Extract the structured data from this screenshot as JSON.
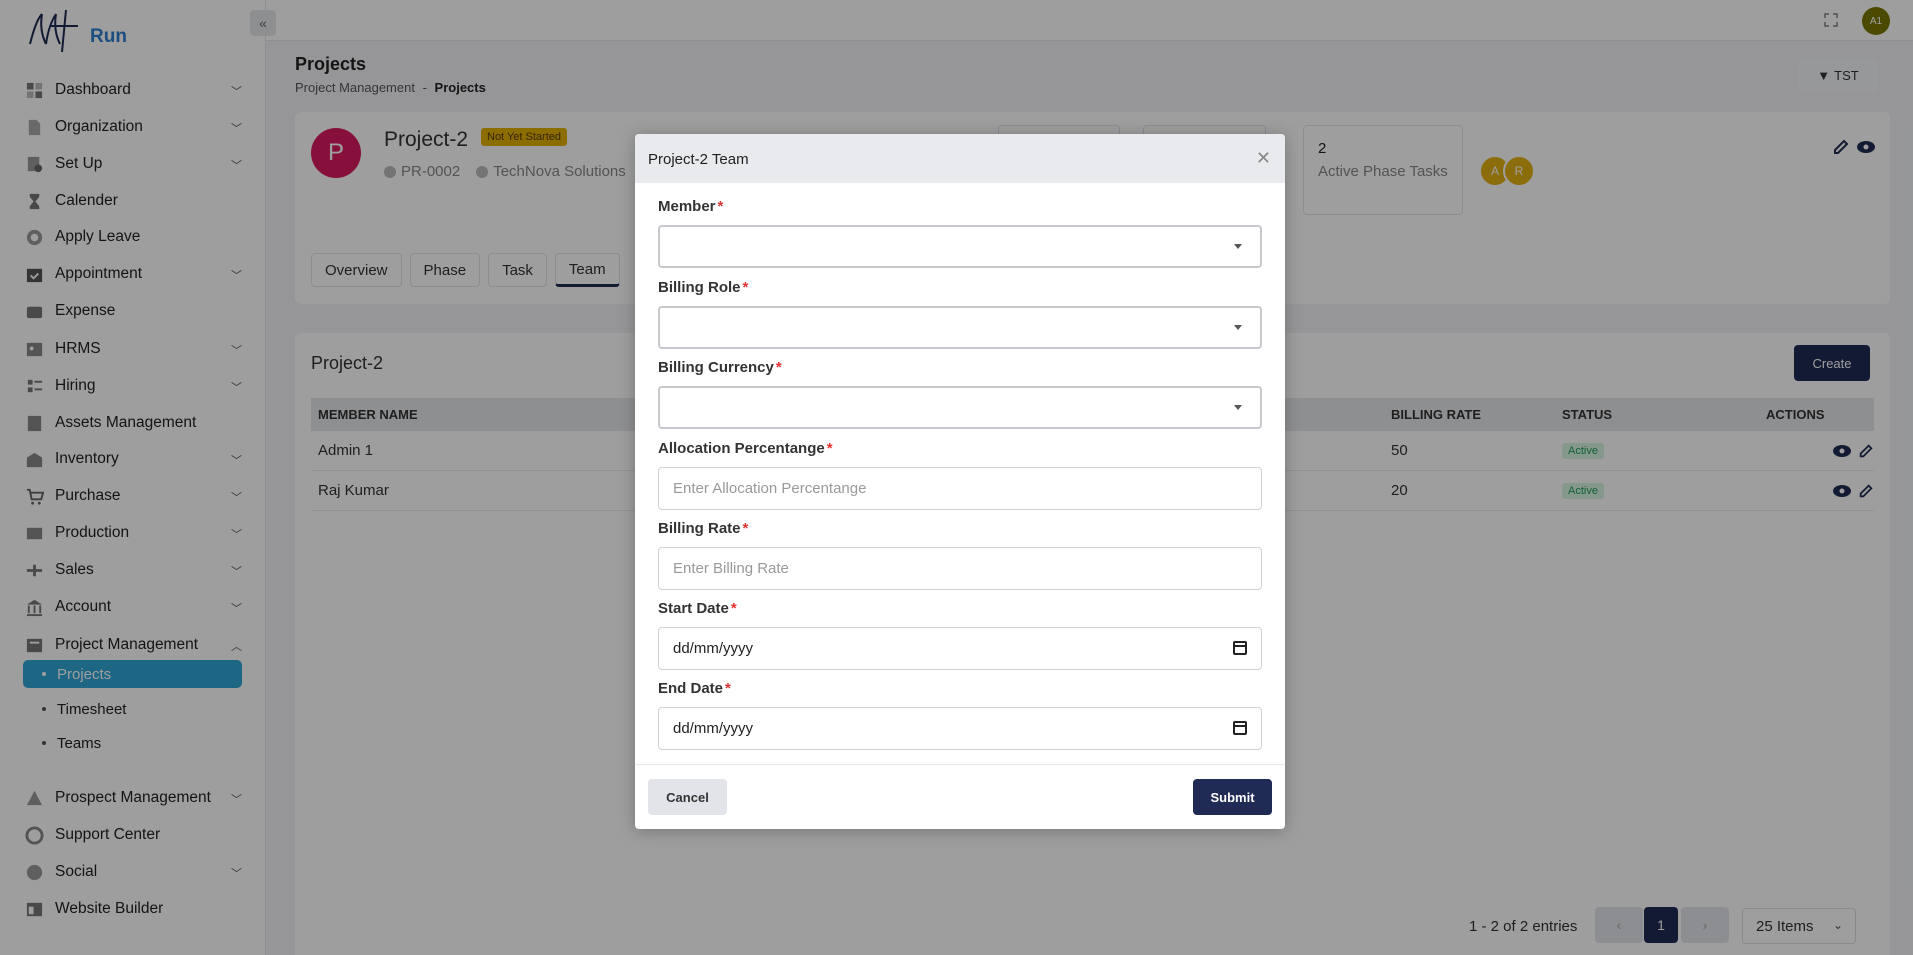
{
  "app": {
    "logo_text": "Run"
  },
  "topbar": {
    "avatar_initials": "A1"
  },
  "sidebar": {
    "items": [
      {
        "label": "Dashboard",
        "icon": "dashboard-icon",
        "has_chevron": true
      },
      {
        "label": "Organization",
        "icon": "document-icon",
        "has_chevron": true
      },
      {
        "label": "Set Up",
        "icon": "setup-icon",
        "has_chevron": true
      },
      {
        "label": "Calender",
        "icon": "hourglass-icon",
        "has_chevron": false
      },
      {
        "label": "Apply Leave",
        "icon": "leave-icon",
        "has_chevron": false
      },
      {
        "label": "Appointment",
        "icon": "calendar-check-icon",
        "has_chevron": true
      },
      {
        "label": "Expense",
        "icon": "wallet-icon",
        "has_chevron": false
      },
      {
        "label": "HRMS",
        "icon": "hrms-icon",
        "has_chevron": true
      },
      {
        "label": "Hiring",
        "icon": "hiring-icon",
        "has_chevron": true
      },
      {
        "label": "Assets Management",
        "icon": "assets-icon",
        "has_chevron": false
      },
      {
        "label": "Inventory",
        "icon": "inventory-icon",
        "has_chevron": true
      },
      {
        "label": "Purchase",
        "icon": "cart-icon",
        "has_chevron": true
      },
      {
        "label": "Production",
        "icon": "production-icon",
        "has_chevron": true
      },
      {
        "label": "Sales",
        "icon": "sales-icon",
        "has_chevron": true
      },
      {
        "label": "Account",
        "icon": "bank-icon",
        "has_chevron": true
      },
      {
        "label": "Project Management",
        "icon": "project-icon",
        "has_chevron": true
      },
      {
        "label": "Prospect Management",
        "icon": "prospect-icon",
        "has_chevron": true
      },
      {
        "label": "Support Center",
        "icon": "support-icon",
        "has_chevron": false
      },
      {
        "label": "Social",
        "icon": "social-icon",
        "has_chevron": true
      },
      {
        "label": "Website Builder",
        "icon": "website-icon",
        "has_chevron": false
      }
    ],
    "sub_items": [
      {
        "label": "Projects",
        "active": true
      },
      {
        "label": "Timesheet",
        "active": false
      },
      {
        "label": "Teams",
        "active": false
      }
    ]
  },
  "page": {
    "title": "Projects",
    "breadcrumb_parent": "Project Management",
    "breadcrumb_sep": "-",
    "breadcrumb_current": "Projects",
    "filter_label": "TST"
  },
  "project": {
    "avatar_letter": "P",
    "name": "Project-2",
    "status_badge": "Not Yet Started",
    "code": "PR-0002",
    "client": "TechNova Solutions",
    "stat_num": "2",
    "stat_label": "Active Phase Tasks",
    "team_avatars": [
      "A",
      "R"
    ],
    "tabs": [
      "Overview",
      "Phase",
      "Task",
      "Team"
    ]
  },
  "table": {
    "title": "Project-2",
    "create_label": "Create",
    "headers": {
      "member": "MEMBER NAME",
      "rate": "BILLING RATE",
      "status": "STATUS",
      "actions": "ACTIONS"
    },
    "rows": [
      {
        "member": "Admin 1",
        "rate": "50",
        "status": "Active"
      },
      {
        "member": "Raj Kumar",
        "rate": "20",
        "status": "Active"
      }
    ],
    "pager_info": "1 - 2 of 2 entries",
    "page_current": "1",
    "per_page": "25 Items"
  },
  "modal": {
    "title": "Project-2 Team",
    "required_mark": "*",
    "member_label": "Member",
    "billing_role_label": "Billing Role",
    "billing_currency_label": "Billing Currency",
    "allocation_label": "Allocation Percentange",
    "allocation_placeholder": "Enter Allocation Percentange",
    "billing_rate_label": "Billing Rate",
    "billing_rate_placeholder": "Enter Billing Rate",
    "start_date_label": "Start Date",
    "start_date_value": "dd/mm/yyyy",
    "end_date_label": "End Date",
    "end_date_value": "dd/mm/yyyy",
    "cancel_label": "Cancel",
    "submit_label": "Submit"
  }
}
